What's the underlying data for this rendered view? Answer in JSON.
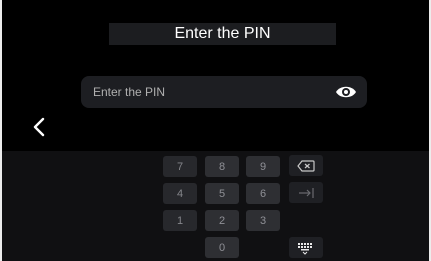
{
  "header": {
    "title": "Enter the PIN"
  },
  "pin_input": {
    "placeholder": "Enter the PIN"
  },
  "keypad": {
    "keys": [
      "7",
      "8",
      "9",
      "4",
      "5",
      "6",
      "1",
      "2",
      "3",
      "0"
    ]
  },
  "icons": {
    "eye": "eye-icon",
    "back": "chevron-left-icon",
    "backspace": "backspace-icon",
    "tab": "tab-arrow-icon",
    "keyboard": "keyboard-hide-icon"
  }
}
